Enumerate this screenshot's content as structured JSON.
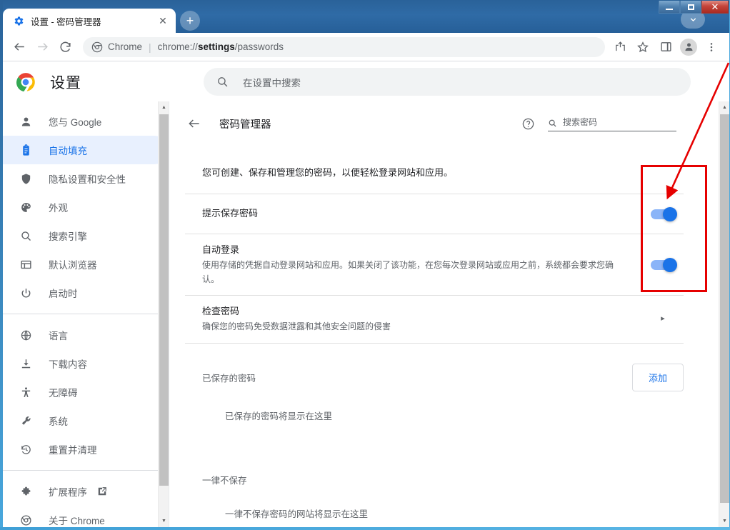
{
  "window": {
    "buttons": [
      {
        "name": "minimize",
        "label": "—"
      },
      {
        "name": "maximize",
        "label": "□"
      },
      {
        "name": "close",
        "label": "✕"
      }
    ]
  },
  "tabs": [
    {
      "title": "设置 - 密码管理器",
      "favicon": "gear-icon",
      "close_label": "✕"
    }
  ],
  "newtab_label": "+",
  "tabstrip_caret_label": "⌄",
  "toolbar": {
    "back_label": "←",
    "forward_label": "→",
    "reload_label": "⟳",
    "omnibox": {
      "scheme_label": "Chrome",
      "separator": "|",
      "url_prefix": "chrome://",
      "url_bold": "settings",
      "url_suffix": "/passwords"
    },
    "share_label": "share-icon",
    "bookmark_label": "☆",
    "sidepanel_label": "sidepanel-icon",
    "profile_label": "profile-icon",
    "menu_label": "⋮"
  },
  "settings_header": {
    "title": "设置",
    "search_placeholder": "在设置中搜索"
  },
  "sidebar": {
    "group1": [
      {
        "icon": "person-icon",
        "label": "您与 Google",
        "active": false
      },
      {
        "icon": "clipboard-icon",
        "label": "自动填充",
        "active": true
      },
      {
        "icon": "shield-icon",
        "label": "隐私设置和安全性",
        "active": false
      },
      {
        "icon": "palette-icon",
        "label": "外观",
        "active": false
      },
      {
        "icon": "search-icon",
        "label": "搜索引擎",
        "active": false
      },
      {
        "icon": "browser-window-icon",
        "label": "默认浏览器",
        "active": false
      },
      {
        "icon": "power-icon",
        "label": "启动时",
        "active": false
      }
    ],
    "group2": [
      {
        "icon": "globe-icon",
        "label": "语言",
        "active": false
      },
      {
        "icon": "download-icon",
        "label": "下载内容",
        "active": false
      },
      {
        "icon": "accessibility-icon",
        "label": "无障碍",
        "active": false
      },
      {
        "icon": "wrench-icon",
        "label": "系统",
        "active": false
      },
      {
        "icon": "restore-icon",
        "label": "重置并清理",
        "active": false
      }
    ],
    "group3": [
      {
        "icon": "puzzle-icon",
        "label": "扩展程序",
        "active": false,
        "external": true
      },
      {
        "icon": "chrome-icon",
        "label": "关于 Chrome",
        "active": false
      }
    ]
  },
  "password_manager": {
    "back_label": "←",
    "title": "密码管理器",
    "help_label": "?",
    "search_placeholder": "搜索密码",
    "description": "您可创建、保存和管理您的密码，以便轻松登录网站和应用。",
    "rows": [
      {
        "name": "offer-to-save-passwords",
        "title": "提示保存密码",
        "sub": "",
        "control": "toggle",
        "toggle_on": true
      },
      {
        "name": "auto-signin",
        "title": "自动登录",
        "sub": "使用存储的凭据自动登录网站和应用。如果关闭了该功能，在您每次登录网站或应用之前，系统都会要求您确认。",
        "control": "toggle",
        "toggle_on": true
      },
      {
        "name": "check-passwords",
        "title": "检查密码",
        "sub": "确保您的密码免受数据泄露和其他安全问题的侵害",
        "control": "chevron",
        "chevron_label": "▸"
      }
    ],
    "saved_section": {
      "title": "已保存的密码",
      "add_button": "添加",
      "empty_text": "已保存的密码将显示在这里"
    },
    "never_section": {
      "title": "一律不保存",
      "empty_text": "一律不保存密码的网站将显示在这里"
    }
  },
  "scrollbars": {
    "up_arrow": "▲",
    "down_arrow": "▼"
  },
  "annotation": {
    "color": "#e60000",
    "shape": "rectangle-with-arrow"
  },
  "colors": {
    "accent_blue": "#1a73e8",
    "toggle_track": "#8ab4f8",
    "active_nav_bg": "#e8f0fe",
    "annotation_red": "#e60000",
    "titlebar_blue": "#2a6299"
  }
}
